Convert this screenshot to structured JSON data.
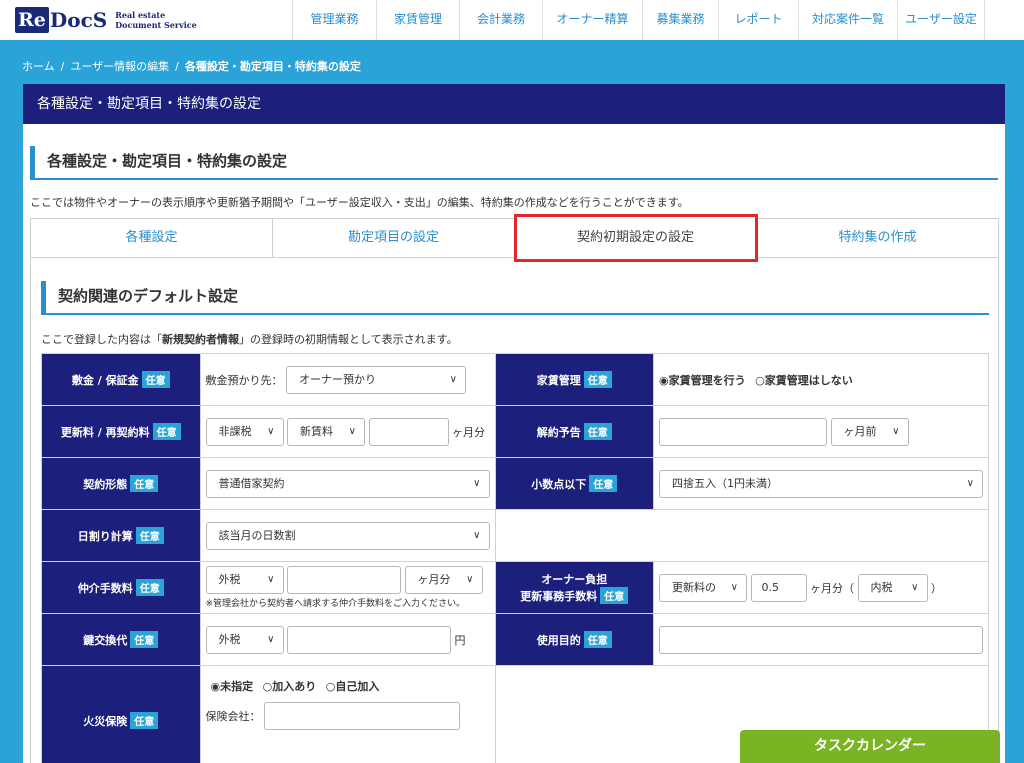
{
  "brand": {
    "re": "Re",
    "docs": "DocS",
    "sub1": "Real estate",
    "sub2": "Document Service"
  },
  "nav": [
    {
      "label": "管理業務",
      "w": 84
    },
    {
      "label": "家賃管理",
      "w": 83
    },
    {
      "label": "会計業務",
      "w": 83
    },
    {
      "label": "オーナー精算",
      "w": 100
    },
    {
      "label": "募集業務",
      "w": 76
    },
    {
      "label": "レポート",
      "w": 80
    },
    {
      "label": "対応案件一覧",
      "w": 99
    },
    {
      "label": "ユーザー設定",
      "w": 88
    }
  ],
  "breadcrumb": {
    "home": "ホーム",
    "parent": "ユーザー情報の編集",
    "current": "各種設定・勘定項目・特約集の設定"
  },
  "panel_title": "各種設定・勘定項目・特約集の設定",
  "section1": {
    "title": "各種設定・勘定項目・特約集の設定",
    "desc": "ここでは物件やオーナーの表示順序や更新猶予期間や「ユーザー設定収入・支出」の編集、特約集の作成などを行うことができます。"
  },
  "tabs": [
    "各種設定",
    "勘定項目の設定",
    "契約初期設定の設定",
    "特約集の作成"
  ],
  "section2": {
    "title": "契約関連のデフォルト設定",
    "desc_pre": "ここで登録した内容は「",
    "desc_bold": "新規契約者情報",
    "desc_post": "」の登録時の初期情報として表示されます。"
  },
  "badge": "任意",
  "fields": {
    "deposit": {
      "label": "敷金 / 保証金",
      "prefix": "敷金預かり先：",
      "value": "オーナー預かり"
    },
    "rent_mgmt": {
      "label": "家賃管理",
      "opt1": "◉家賃管理を行う",
      "opt2": "○家賃管理はしない"
    },
    "renewal": {
      "label": "更新料 / 再契約料",
      "tax": "非課税",
      "base": "新賃料",
      "unit": "ヶ月分"
    },
    "notice": {
      "label": "解約予告",
      "unit": "ヶ月前"
    },
    "contract": {
      "label": "契約形態",
      "value": "普通借家契約"
    },
    "decimal": {
      "label": "小数点以下",
      "value": "四捨五入（1円未満）"
    },
    "daily": {
      "label": "日割り計算",
      "value": "該当月の日数割"
    },
    "brokerage": {
      "label": "仲介手数料",
      "tax": "外税",
      "unit": "ヶ月分",
      "note": "※管理会社から契約者へ請求する仲介手数料をご入力ください。"
    },
    "owner_fee": {
      "label1": "オーナー負担",
      "label2": "更新事務手数料",
      "base": "更新料の",
      "amount": "0.5",
      "unit": "ヶ月分（",
      "tax": "内税",
      "close": "）"
    },
    "key": {
      "label": "鍵交換代",
      "tax": "外税",
      "unit": "円"
    },
    "purpose": {
      "label": "使用目的"
    },
    "fire": {
      "label": "火災保険",
      "opt1": "◉未指定",
      "opt2": "○加入あり",
      "opt3": "○自己加入",
      "company": "保険会社："
    }
  },
  "task_button": "タスクカレンダー"
}
